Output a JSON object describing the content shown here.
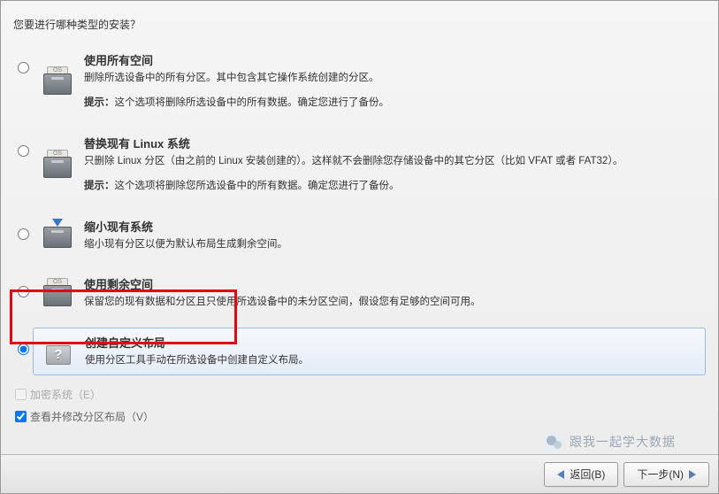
{
  "prompt": "您要进行哪种类型的安装？",
  "options": [
    {
      "id": "use-all",
      "title": "使用所有空间",
      "desc": "删除所选设备中的所有分区。其中包含其它操作系统创建的分区。",
      "hint_label": "提示：",
      "hint": "这个选项将删除所选设备中的所有数据。确定您进行了备份。",
      "selected": false,
      "icon": "os"
    },
    {
      "id": "replace-linux",
      "title": "替换现有 Linux 系统",
      "desc": "只删除 Linux 分区（由之前的 Linux 安装创建的）。这样就不会删除您存储设备中的其它分区（比如 VFAT 或者 FAT32）。",
      "hint_label": "提示：",
      "hint": "这个选项将删除您所选设备中的所有数据。确定您进行了备份。",
      "selected": false,
      "icon": "os"
    },
    {
      "id": "shrink",
      "title": "缩小现有系统",
      "desc": "缩小现有分区以便为默认布局生成剩余空间。",
      "hint_label": "",
      "hint": "",
      "selected": false,
      "icon": "shrink"
    },
    {
      "id": "use-free",
      "title": "使用剩余空间",
      "desc": "保留您的现有数据和分区且只使用所选设备中的未分区空间，假设您有足够的空间可用。",
      "hint_label": "",
      "hint": "",
      "selected": false,
      "icon": "os"
    },
    {
      "id": "custom",
      "title": "创建自定义布局",
      "desc": "使用分区工具手动在所选设备中创建自定义布局。",
      "hint_label": "",
      "hint": "",
      "selected": true,
      "icon": "question"
    }
  ],
  "checks": {
    "encrypt": {
      "label": "加密系统（E）",
      "checked": false,
      "enabled": false
    },
    "review": {
      "label": "查看并修改分区布局（V）",
      "checked": true,
      "enabled": true
    }
  },
  "watermark": "跟我一起学大数据",
  "footer": {
    "back": "返回(B)",
    "next": "下一步(N)"
  }
}
